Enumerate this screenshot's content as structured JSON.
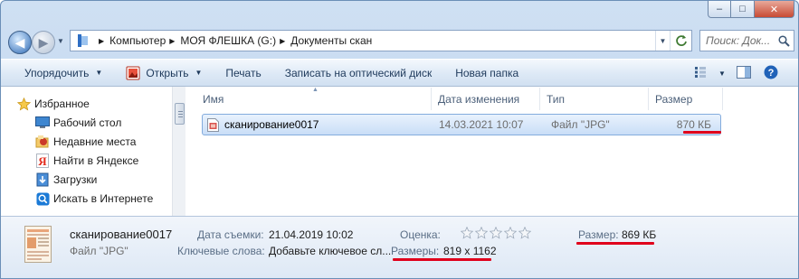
{
  "window": {
    "caption": {
      "minimize": "–",
      "maximize": "□",
      "close": "✕"
    }
  },
  "navigation": {
    "back_icon": "back-arrow-icon",
    "forward_icon": "forward-arrow-icon",
    "breadcrumbs": [
      "Компьютер",
      "МОЯ ФЛЕШКА (G:)",
      "Документы скан"
    ],
    "search_placeholder": "Поиск: Док..."
  },
  "toolbar": {
    "organize": "Упорядочить",
    "open": "Открыть",
    "print": "Печать",
    "burn": "Записать на оптический диск",
    "new_folder": "Новая папка"
  },
  "sidebar": {
    "items": [
      {
        "label": "Избранное",
        "icon": "star-icon"
      },
      {
        "label": "Рабочий стол",
        "icon": "desktop-icon"
      },
      {
        "label": "Недавние места",
        "icon": "recent-places-icon"
      },
      {
        "label": "Найти в Яндексе",
        "icon": "yandex-icon"
      },
      {
        "label": "Загрузки",
        "icon": "downloads-icon"
      },
      {
        "label": "Искать в Интернете",
        "icon": "search-web-icon"
      }
    ]
  },
  "file_list": {
    "columns": [
      "Имя",
      "Дата изменения",
      "Тип",
      "Размер"
    ],
    "rows": [
      {
        "name": "сканирование0017",
        "date": "14.03.2021 10:07",
        "type": "Файл \"JPG\"",
        "size": "870 КБ"
      }
    ]
  },
  "details": {
    "name": "сканирование0017",
    "type": "Файл \"JPG\"",
    "date_taken_label": "Дата съемки:",
    "date_taken": "21.04.2019 10:02",
    "keywords_label": "Ключевые слова:",
    "keywords": "Добавьте ключевое сл...",
    "rating_label": "Оценка:",
    "rating": 0,
    "rating_max": 5,
    "dimensions_label": "Размеры:",
    "dimensions": "819 x 1162",
    "size_label": "Размер:",
    "size": "869 КБ"
  },
  "colors": {
    "accent": "#2d69b4",
    "selection": "#c9def7",
    "highlight_underline": "#e0001b"
  }
}
